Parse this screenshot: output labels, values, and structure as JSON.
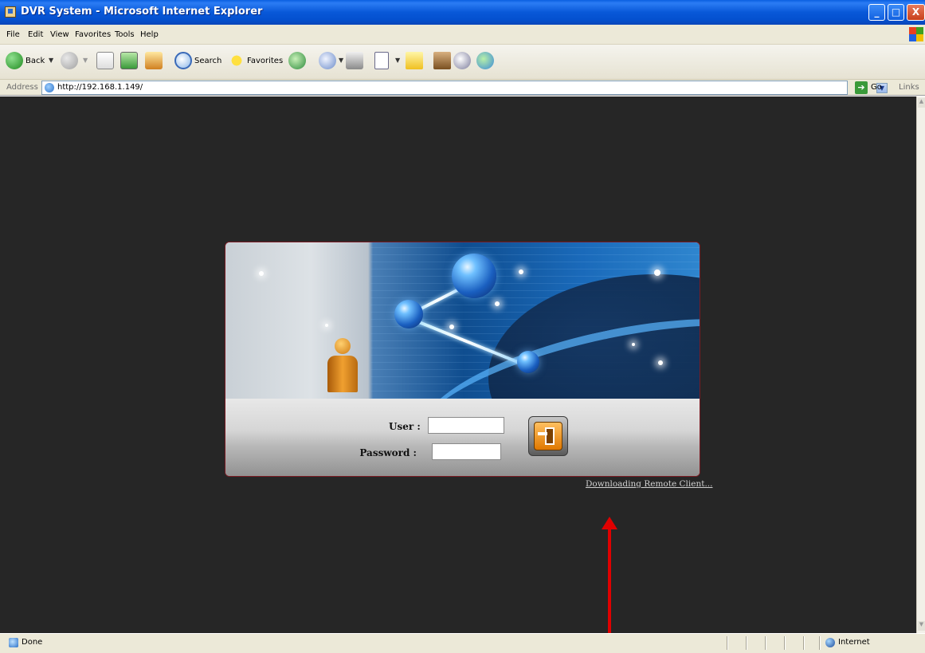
{
  "window": {
    "title": "DVR System - Microsoft Internet Explorer",
    "controls": {
      "minimize": "_",
      "maximize": "□",
      "close": "X"
    }
  },
  "menu": {
    "items": [
      "File",
      "Edit",
      "View",
      "Favorites",
      "Tools",
      "Help"
    ]
  },
  "toolbar": {
    "back_label": "Back",
    "search_label": "Search",
    "favorites_label": "Favorites"
  },
  "address_bar": {
    "label": "Address",
    "url": "http://192.168.1.149/",
    "go_label": "Go",
    "links_label": "Links"
  },
  "login": {
    "user_label": "User :",
    "password_label": "Password :",
    "user_value": "",
    "password_value": "",
    "download_link": "Downloading Remote Client..."
  },
  "status_bar": {
    "status_text": "Done",
    "zone_text": "Internet"
  },
  "colors": {
    "title_bar": "#0858d8",
    "content_bg": "#262626",
    "panel_border": "#7a1a22",
    "login_button": "#e07800",
    "annotation_arrow": "#e00000"
  }
}
